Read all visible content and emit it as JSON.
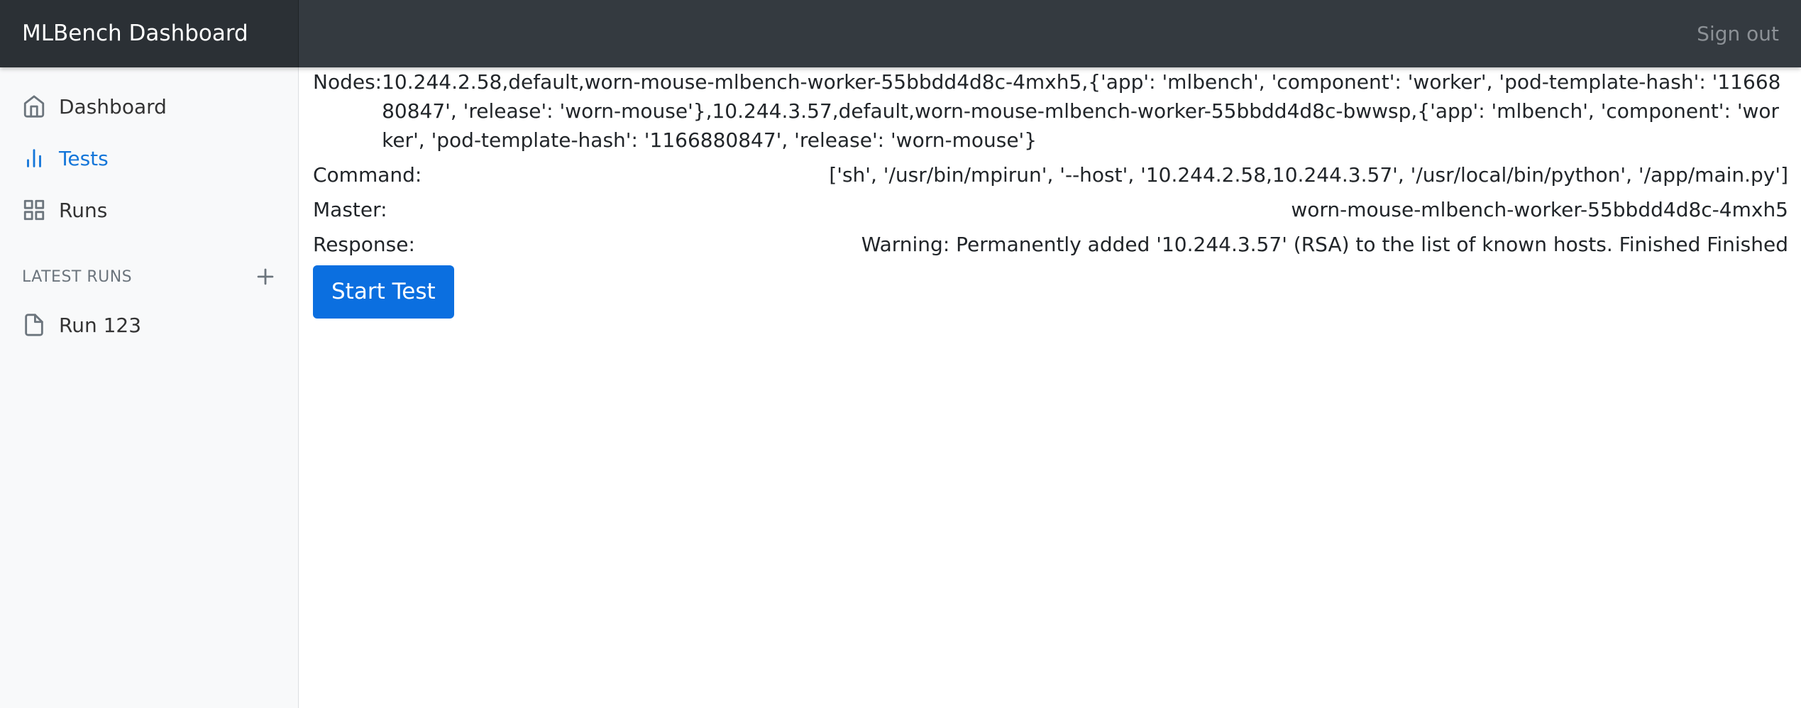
{
  "header": {
    "brand": "MLBench Dashboard",
    "signout_label": "Sign out"
  },
  "sidebar": {
    "items": [
      {
        "label": "Dashboard",
        "icon": "home-icon",
        "active": false
      },
      {
        "label": "Tests",
        "icon": "bar-chart-icon",
        "active": true
      },
      {
        "label": "Runs",
        "icon": "grid-icon",
        "active": false
      }
    ],
    "latest_runs_heading": "LATEST RUNS",
    "add_icon": "plus-icon",
    "runs": [
      {
        "label": "Run 123",
        "icon": "file-icon"
      }
    ],
    "accent_color": "#1476d9"
  },
  "main": {
    "nodes_label": "Nodes:",
    "nodes_value": "10.244.2.58,default,worn-mouse-mlbench-worker-55bbdd4d8c-4mxh5,{'app': 'mlbench', 'component': 'worker', 'pod-template-hash': '1166880847', 'release': 'worn-mouse'},10.244.3.57,default,worn-mouse-mlbench-worker-55bbdd4d8c-bwwsp,{'app': 'mlbench', 'component': 'worker', 'pod-template-hash': '1166880847', 'release': 'worn-mouse'}",
    "command_label": "Command:",
    "command_value": "['sh', '/usr/bin/mpirun', '--host', '10.244.2.58,10.244.3.57', '/usr/local/bin/python', '/app/main.py']",
    "master_label": "Master:",
    "master_value": "worn-mouse-mlbench-worker-55bbdd4d8c-4mxh5",
    "response_label": "Response:",
    "response_value": "Warning: Permanently added '10.244.3.57' (RSA) to the list of known hosts. Finished Finished",
    "start_button_label": "Start Test",
    "button_color": "#0b6fe0"
  }
}
